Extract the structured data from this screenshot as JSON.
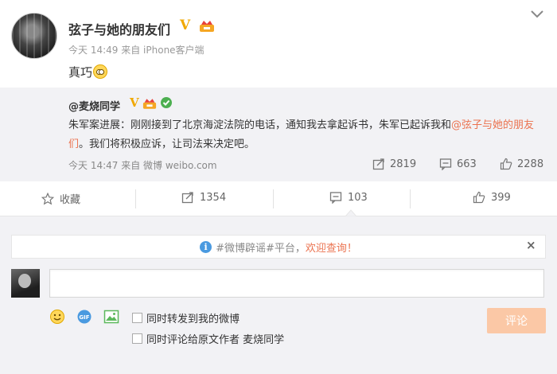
{
  "post": {
    "username": "弦子与她的朋友们",
    "verified_mark": "V",
    "time": "今天 14:49",
    "source": "来自 iPhone客户端",
    "text": "真巧"
  },
  "repost": {
    "username": "@麦烧同学",
    "verified_mark": "V",
    "text_before": "朱军案进展：刚刚接到了北京海淀法院的电话，通知我去拿起诉书，朱军已起诉我和",
    "mention": "@弦子与她的朋友们",
    "text_after": "。我们将积极应诉，让司法来决定吧。",
    "time": "今天 14:47",
    "source": "来自 微博 weibo.com",
    "reposts": "2819",
    "comments": "663",
    "likes": "2288"
  },
  "actions": {
    "favorite": "收藏",
    "repost": "1354",
    "comment": "103",
    "like": "399"
  },
  "comment_panel": {
    "notice_prefix": "#微博辟谣#平台，",
    "notice_link": "欢迎查询！",
    "close": "×",
    "input_value": "",
    "option_repost": "同时转发到我的微博",
    "option_comment_author": "同时评论给原文作者 麦烧同学",
    "submit": "评论"
  },
  "colors": {
    "accent_orange": "#eb7350",
    "verified_gold": "#f0a800",
    "submit_bg": "#fbc8a6",
    "panel_bg": "#f2f2f5"
  }
}
